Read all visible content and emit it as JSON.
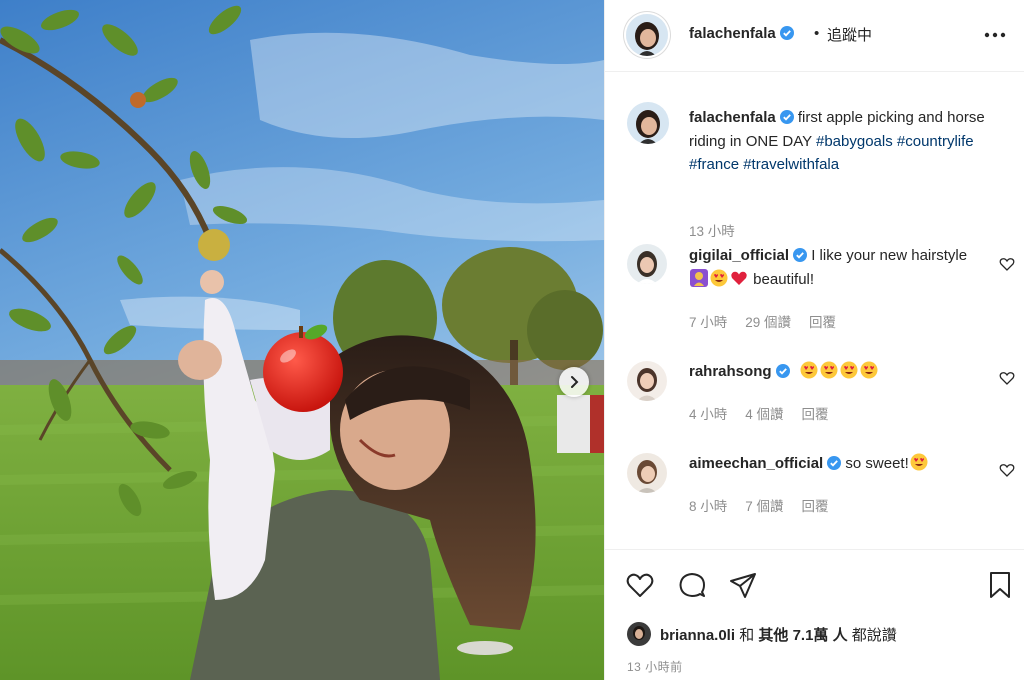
{
  "header": {
    "username": "falachenfala",
    "separator": "•",
    "follow_status": "追蹤中"
  },
  "caption": {
    "username": "falachenfala",
    "text": "first apple picking and horse riding in ONE DAY",
    "hashtags": [
      "#babygoals",
      "#countrylife",
      "#france",
      "#travelwithfala"
    ],
    "time": "13 小時"
  },
  "comments": [
    {
      "username": "gigilai_official",
      "text_before": "I like your new hairstyle",
      "emojis": [
        "woman-gesturing-icon",
        "heart-eyes-icon",
        "red-heart-icon"
      ],
      "text_after": "beautiful!",
      "time": "7 小時",
      "likes": "29 個讚",
      "reply": "回覆"
    },
    {
      "username": "rahrahsong",
      "text_before": "",
      "emojis": [
        "heart-eyes-icon",
        "heart-eyes-icon",
        "heart-eyes-icon",
        "heart-eyes-icon"
      ],
      "text_after": "",
      "time": "4 小時",
      "likes": "4 個讚",
      "reply": "回覆"
    },
    {
      "username": "aimeechan_official",
      "text_before": "so sweet!",
      "emojis": [
        "heart-eyes-icon"
      ],
      "text_after": "",
      "time": "8 小時",
      "likes": "7 個讚",
      "reply": "回覆"
    }
  ],
  "actions": {
    "icons": [
      "heart-icon",
      "comment-icon",
      "share-icon",
      "bookmark-icon"
    ]
  },
  "likes": {
    "user": "brianna.0li",
    "connector": "和",
    "others_label": "其他",
    "count": "7.1萬",
    "suffix_person": "人",
    "suffix_liked": "都說讚"
  },
  "post_time": "13 小時前",
  "colors": {
    "verified": "#3897f0",
    "hashtag": "#00376b",
    "muted": "#8e8e8e",
    "border": "#efefef"
  }
}
